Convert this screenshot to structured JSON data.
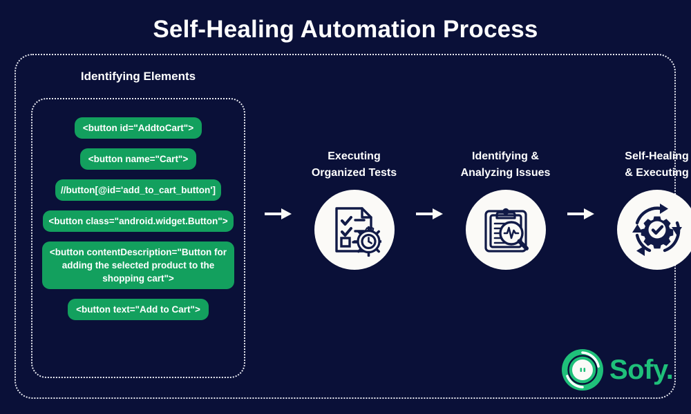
{
  "page": {
    "title": "Self-Healing Automation Process",
    "background_color": "#0a1038",
    "accent_green": "#13a05e",
    "logo_green": "#1fc07a",
    "frame_color": "#e9eaf2"
  },
  "left_panel": {
    "heading": "Identifying Elements",
    "tags": [
      {
        "text": "<button id=\"AddtoCart\">"
      },
      {
        "text": "<button name=\"Cart\">"
      },
      {
        "text": "//button[@id='add_to_cart_button']"
      },
      {
        "text": "<button class=\"android.widget.Button\">"
      },
      {
        "text": "<button contentDescription=\"Button for adding the selected product to the shopping cart\">"
      },
      {
        "text": "<button text=\"Add to Cart\">"
      }
    ]
  },
  "steps": [
    {
      "label": "Executing\nOrganized Tests",
      "icon": "checklist-document-gear-icon"
    },
    {
      "label": "Identifying &\nAnalyzing Issues",
      "icon": "clipboard-magnifier-pulse-icon"
    },
    {
      "label": "Self-Healing\n& Executing",
      "icon": "gear-check-cycle-arrows-icon"
    }
  ],
  "arrows": [
    {
      "name": "arrow-right-1"
    },
    {
      "name": "arrow-right-2"
    },
    {
      "name": "arrow-right-3"
    }
  ],
  "logo": {
    "wordmark": "Sofy.",
    "mark": "sofy-circle-logo-icon"
  }
}
